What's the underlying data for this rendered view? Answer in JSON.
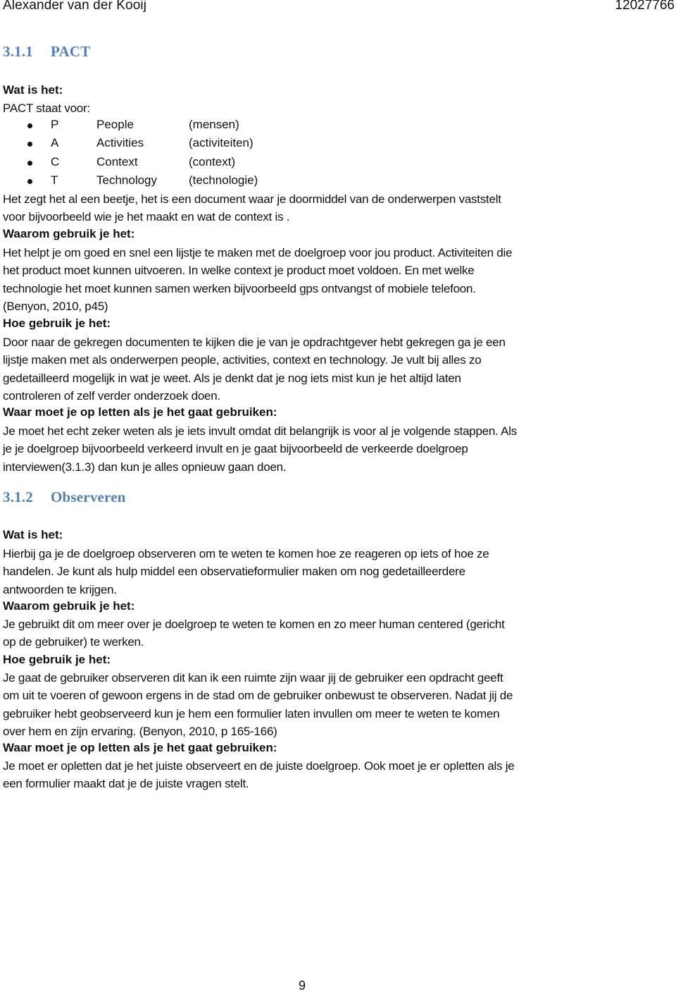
{
  "header": {
    "author": "Alexander van der Kooij",
    "student_number": "12027766"
  },
  "section1": {
    "number": "3.1.1",
    "title": "PACT",
    "what_label": "Wat is het:",
    "intro": "PACT staat voor:",
    "bullets": [
      {
        "letter": "P",
        "word": "People",
        "translation": "(mensen)"
      },
      {
        "letter": "A",
        "word": "Activities",
        "translation": "(activiteiten)"
      },
      {
        "letter": "C",
        "word": "Context",
        "translation": "(context)"
      },
      {
        "letter": "T",
        "word": "Technology",
        "translation": "(technologie)"
      }
    ],
    "what_text": [
      "Het zegt het al een beetje, het is een document waar je doormiddel van de onderwerpen vaststelt",
      "voor bijvoorbeeld wie je het maakt en wat de context is ."
    ],
    "why_label": "Waarom gebruik je het:",
    "why_text": [
      "Het helpt je om goed en snel een lijstje te maken met de doelgroep voor jou product. Activiteiten die",
      "het product moet kunnen uitvoeren. In welke context je product moet voldoen. En met welke",
      "technologie het moet kunnen samen werken bijvoorbeeld gps ontvangst of mobiele telefoon.",
      "(Benyon, 2010, p45)"
    ],
    "how_label": "Hoe gebruik je het:",
    "how_text": [
      "Door naar de gekregen documenten te kijken die je van je opdrachtgever hebt gekregen ga je een",
      "lijstje maken met als onderwerpen people, activities, context en technology. Je vult bij alles zo",
      "gedetailleerd mogelijk in wat je weet. Als je denkt dat je nog iets mist kun je het altijd laten",
      "controleren of zelf verder onderzoek doen."
    ],
    "attention_label": "Waar moet je op letten als je het gaat gebruiken:",
    "attention_text": [
      "Je moet het echt zeker weten als je iets invult omdat dit belangrijk is voor al je volgende stappen. Als",
      "je je doelgroep bijvoorbeeld verkeerd invult en je gaat bijvoorbeeld de verkeerde doelgroep",
      "interviewen(3.1.3) dan kun je alles opnieuw gaan doen."
    ]
  },
  "section2": {
    "number": "3.1.2",
    "title": "Observeren",
    "what_label": "Wat is het:",
    "what_text": [
      "Hierbij ga je de doelgroep observeren om te weten te komen hoe ze reageren op iets of hoe ze",
      "handelen. Je kunt als hulp middel een observatieformulier maken om nog gedetailleerdere",
      "antwoorden te krijgen."
    ],
    "why_label": "Waarom gebruik je het:",
    "why_text": [
      "Je gebruikt dit om meer over je doelgroep te weten te komen en zo meer human centered (gericht",
      "op de gebruiker) te werken."
    ],
    "how_label": "Hoe gebruik je het:",
    "how_text": [
      "Je gaat de gebruiker observeren dit kan ik een ruimte zijn waar jij de gebruiker een opdracht geeft",
      "om uit te voeren of gewoon ergens in de stad om de gebruiker onbewust te observeren. Nadat jij de",
      "gebruiker hebt geobserveerd kun je hem een formulier laten invullen om meer te weten te komen",
      "over hem en zijn ervaring. (Benyon, 2010, p 165-166)"
    ],
    "attention_label": "Waar moet je op letten als je het gaat gebruiken:",
    "attention_text": [
      "Je moet er opletten dat je het juiste observeert en de juiste doelgroep. Ook moet je er opletten als je",
      "een formulier maakt dat je de juiste vragen stelt."
    ]
  },
  "footer": {
    "page_number": "9"
  }
}
